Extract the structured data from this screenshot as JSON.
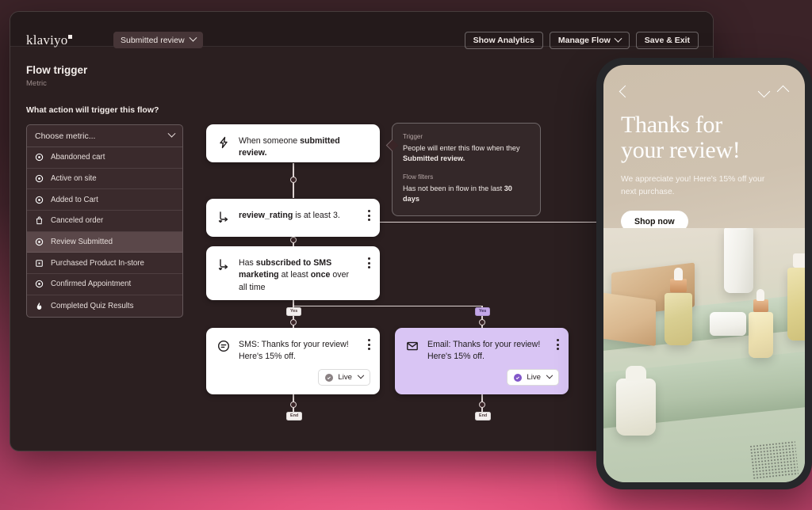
{
  "app": {
    "logo": "klaviyo",
    "flow_selector": "Submitted review",
    "buttons": {
      "show_analytics": "Show Analytics",
      "manage_flow": "Manage Flow",
      "save_exit": "Save & Exit"
    }
  },
  "panel": {
    "title": "Flow trigger",
    "subtitle": "Metric",
    "question": "What action will trigger this flow?",
    "dropdown_placeholder": "Choose metric...",
    "options": [
      {
        "label": "Abandoned cart",
        "icon": "target-icon",
        "selected": false
      },
      {
        "label": "Active on site",
        "icon": "target-icon",
        "selected": false
      },
      {
        "label": "Added to Cart",
        "icon": "target-icon",
        "selected": false
      },
      {
        "label": "Canceled order",
        "icon": "shopping-bag-icon",
        "selected": false
      },
      {
        "label": "Review Submitted",
        "icon": "target-icon",
        "selected": true
      },
      {
        "label": "Purchased Product In-store",
        "icon": "square-dot-icon",
        "selected": false
      },
      {
        "label": "Confirmed Appointment",
        "icon": "target-icon",
        "selected": false
      },
      {
        "label": "Completed Quiz Results",
        "icon": "flame-icon",
        "selected": false
      }
    ]
  },
  "flow": {
    "trigger_node": {
      "icon": "bolt-icon",
      "text_pre": "When someone ",
      "text_bold": "submitted review."
    },
    "condition_node": {
      "icon": "branch-icon",
      "text_bold": "review_rating",
      "text_post": " is at least 3."
    },
    "sms_check_node": {
      "icon": "branch-icon",
      "line1_pre": "Has ",
      "line1_bold": "subscribed to SMS",
      "line2_bold": "marketing",
      "line2_mid": " at least ",
      "line2_bold2": "once",
      "line3": "over all time"
    },
    "sms_message_node": {
      "icon": "sms-icon",
      "text": "SMS: Thanks for your review! Here's 15% off.",
      "status": "Live"
    },
    "email_message_node": {
      "icon": "envelope-icon",
      "text": "Email: Thanks for your review! Here's 15% off.",
      "status": "Live"
    },
    "edge_labels": {
      "yes": "Yes",
      "end": "End"
    }
  },
  "tooltip": {
    "trigger_label": "Trigger",
    "trigger_text_pre": "People will enter this flow when they ",
    "trigger_text_bold": "Submitted review.",
    "filters_label": "Flow filters",
    "filters_text_pre": "Has not been in flow in the last ",
    "filters_text_bold": "30 days"
  },
  "phone": {
    "nav": {
      "back": "back-chevron-icon",
      "down": "chevron-down-icon",
      "up": "chevron-up-icon"
    },
    "title_line1": "Thanks for",
    "title_line2": "your review!",
    "subtitle": "We appreciate you! Here's 15% off your next purchase.",
    "cta": "Shop now"
  },
  "colors": {
    "accent_purple": "#8257c9",
    "node_purple": "#d9c5f4",
    "panel_dark": "#2b1f20",
    "canvas_dark": "#3a2527"
  }
}
